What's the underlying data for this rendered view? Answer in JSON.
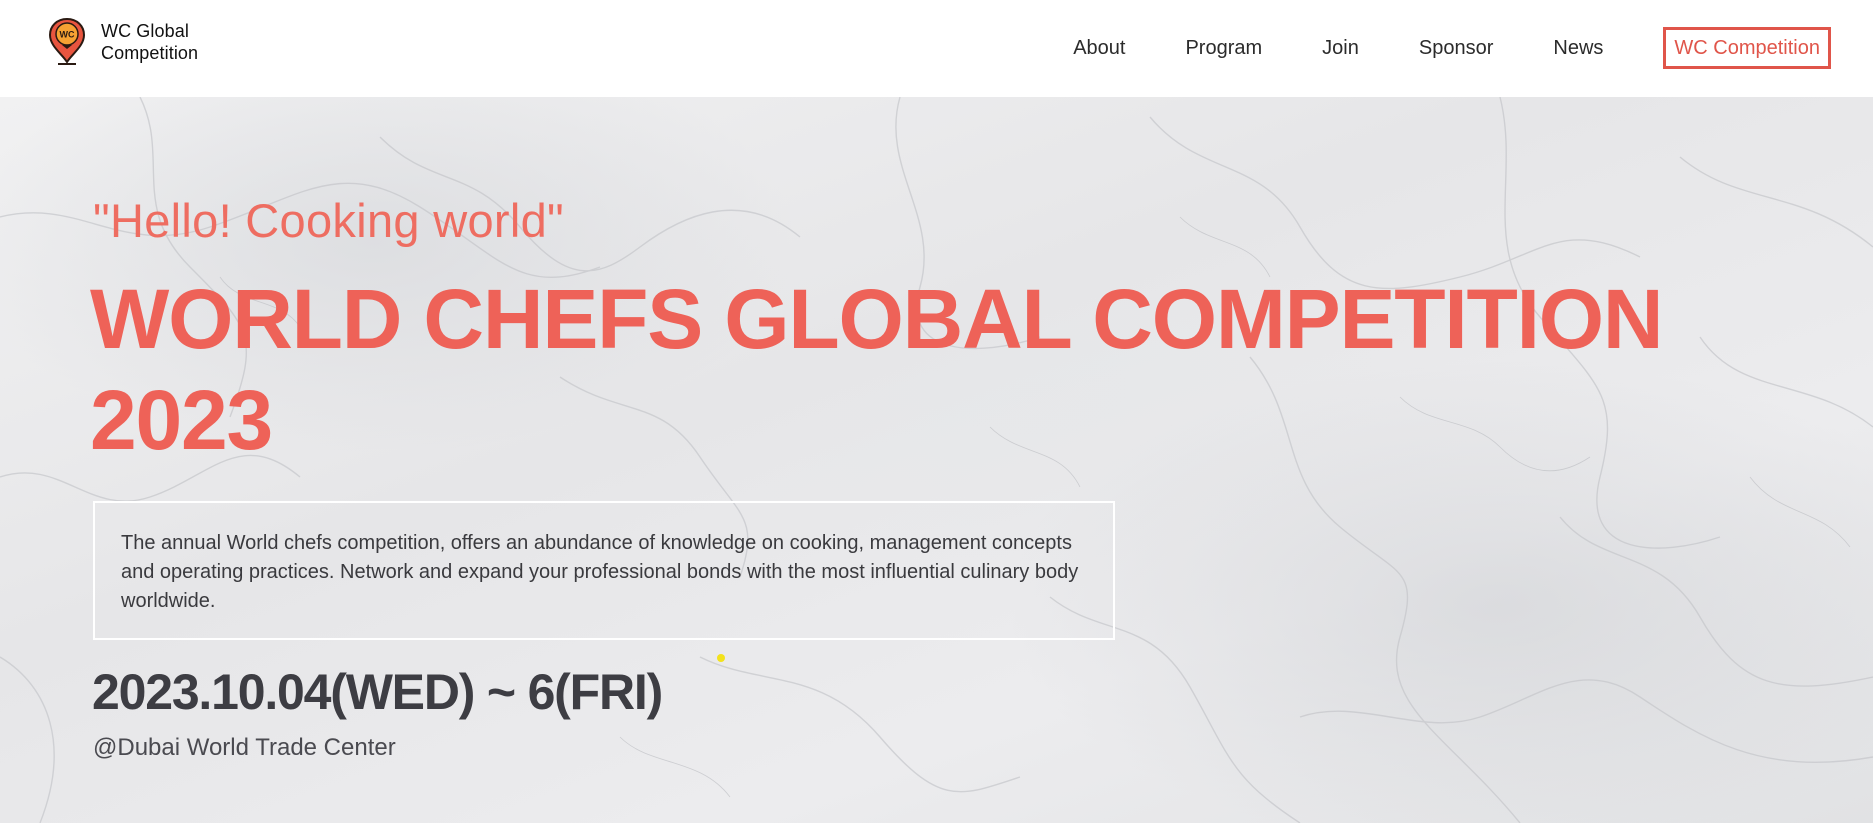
{
  "header": {
    "brand": {
      "line1": "WC Global",
      "line2": "Competition",
      "logo_text": "WC",
      "logo_icon": "map-pin-logo-icon"
    },
    "nav": [
      {
        "label": "About"
      },
      {
        "label": "Program"
      },
      {
        "label": "Join"
      },
      {
        "label": "Sponsor"
      },
      {
        "label": "News"
      }
    ],
    "cta_label": "WC Competition"
  },
  "hero": {
    "tagline": "\"Hello! Cooking world\"",
    "headline_line1": "WORLD CHEFS GLOBAL COMPETITION",
    "headline_line2": "2023",
    "description": "The annual World chefs competition, offers an abundance of knowledge on cooking, management concepts and operating practices. Network and expand your professional bonds with the most influential culinary body worldwide.",
    "date": "2023.10.04(WED) ~ 6(FRI)",
    "venue": "@Dubai World Trade Center"
  },
  "colors": {
    "accent": "#ee6258",
    "cta_border": "#e0554a",
    "text_dark": "#3d3d43",
    "marble_base": "#ececee"
  }
}
